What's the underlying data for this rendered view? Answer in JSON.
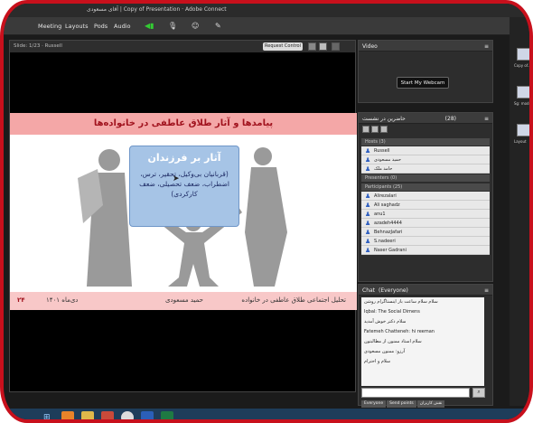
{
  "window": {
    "title": "آقای مسعودی | Copy of Presentation · Adobe Connect"
  },
  "menubar": {
    "items": [
      "Meeting",
      "Layouts",
      "Pods",
      "Audio"
    ]
  },
  "share": {
    "doc": "Slide: 1/23 · Russell",
    "request_control": "Request Control"
  },
  "slide": {
    "title": "پیامدها و آثار طلاق عاطفی در خانواده‌ها",
    "card_title": "آثار بر فرزندان",
    "card_body": "(قربانیان بی‌وکیل، تحقیر، ترس، اضطراب، ضعف تحصیلی، ضعف کارکردی)",
    "footer_title": "تحلیل اجتماعی طلاق عاطفی در خانواده",
    "footer_author": "حمید مسعودی",
    "footer_date": "دی‌ماه ۱۴۰۱",
    "page_number": "۲۴"
  },
  "video": {
    "header": "Video",
    "button": "Start My Webcam"
  },
  "attendees": {
    "header": "حاضرین در نشست",
    "count": "(28)",
    "hosts_label": "Hosts (3)",
    "hosts": [
      "Russell",
      "حمید مسعودی",
      "حامد ملک"
    ],
    "presenters_label": "Presenters (0)",
    "participants_label": "Participants (25)",
    "participants": [
      "Alirezalari",
      "Ali saghadz",
      "anu1",
      "azadeh4444",
      "BehnazJafari",
      "S.nadeeri",
      "Naser Gadrani"
    ]
  },
  "chat": {
    "header": "Chat",
    "scope": "(Everyone)",
    "messages": [
      "سلام سلام ساعت باز اینستاگرام روشن",
      "Iqbal: The Social Dimens",
      "سلام دکتر خوش آمدید",
      "Fatemeh Chatteneh: hi reeman",
      "سلام استاد ممنون از مطالبتون",
      "آرزو: ممنون مسعودی",
      "سلام و احترام"
    ],
    "tabs": [
      "Everyone",
      "Send points",
      "نقش کاربران"
    ]
  },
  "sidestrip": {
    "labels": [
      "Copy of...",
      "Sg: model",
      "Layout"
    ]
  },
  "colors": {
    "frame": "#c8101c",
    "title_band": "#f4a7a7",
    "title_text": "#a1131e",
    "card": "#a6c4e6",
    "footer_band": "#f8c8c8"
  },
  "icons": [
    "mic-icon",
    "webcam-icon",
    "speaker-icon",
    "user-icon",
    "send-icon",
    "windows-start-icon",
    "chrome-icon",
    "folder-icon",
    "word-icon",
    "excel-icon"
  ]
}
